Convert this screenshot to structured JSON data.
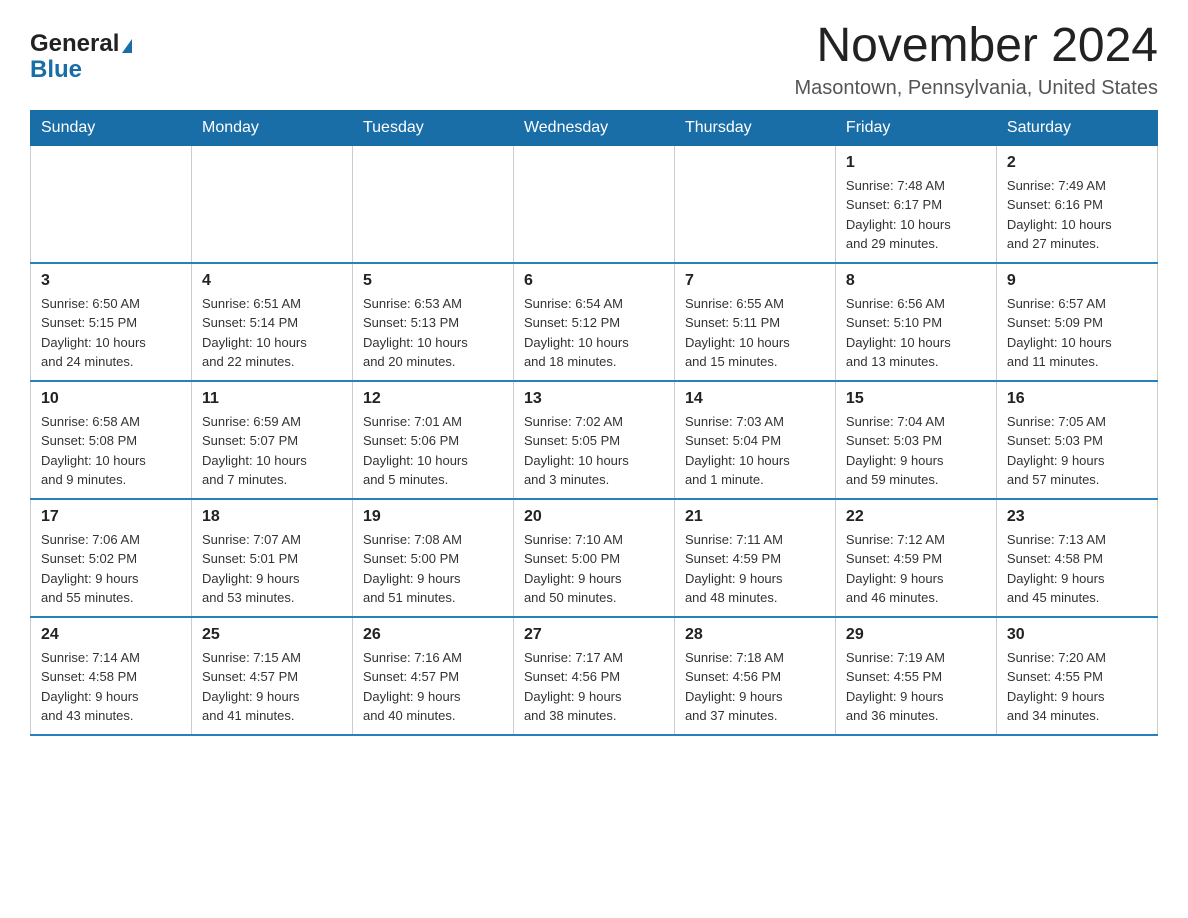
{
  "header": {
    "logo_general": "General",
    "logo_blue": "Blue",
    "month_title": "November 2024",
    "location": "Masontown, Pennsylvania, United States"
  },
  "weekdays": [
    "Sunday",
    "Monday",
    "Tuesday",
    "Wednesday",
    "Thursday",
    "Friday",
    "Saturday"
  ],
  "weeks": [
    [
      {
        "day": "",
        "info": ""
      },
      {
        "day": "",
        "info": ""
      },
      {
        "day": "",
        "info": ""
      },
      {
        "day": "",
        "info": ""
      },
      {
        "day": "",
        "info": ""
      },
      {
        "day": "1",
        "info": "Sunrise: 7:48 AM\nSunset: 6:17 PM\nDaylight: 10 hours\nand 29 minutes."
      },
      {
        "day": "2",
        "info": "Sunrise: 7:49 AM\nSunset: 6:16 PM\nDaylight: 10 hours\nand 27 minutes."
      }
    ],
    [
      {
        "day": "3",
        "info": "Sunrise: 6:50 AM\nSunset: 5:15 PM\nDaylight: 10 hours\nand 24 minutes."
      },
      {
        "day": "4",
        "info": "Sunrise: 6:51 AM\nSunset: 5:14 PM\nDaylight: 10 hours\nand 22 minutes."
      },
      {
        "day": "5",
        "info": "Sunrise: 6:53 AM\nSunset: 5:13 PM\nDaylight: 10 hours\nand 20 minutes."
      },
      {
        "day": "6",
        "info": "Sunrise: 6:54 AM\nSunset: 5:12 PM\nDaylight: 10 hours\nand 18 minutes."
      },
      {
        "day": "7",
        "info": "Sunrise: 6:55 AM\nSunset: 5:11 PM\nDaylight: 10 hours\nand 15 minutes."
      },
      {
        "day": "8",
        "info": "Sunrise: 6:56 AM\nSunset: 5:10 PM\nDaylight: 10 hours\nand 13 minutes."
      },
      {
        "day": "9",
        "info": "Sunrise: 6:57 AM\nSunset: 5:09 PM\nDaylight: 10 hours\nand 11 minutes."
      }
    ],
    [
      {
        "day": "10",
        "info": "Sunrise: 6:58 AM\nSunset: 5:08 PM\nDaylight: 10 hours\nand 9 minutes."
      },
      {
        "day": "11",
        "info": "Sunrise: 6:59 AM\nSunset: 5:07 PM\nDaylight: 10 hours\nand 7 minutes."
      },
      {
        "day": "12",
        "info": "Sunrise: 7:01 AM\nSunset: 5:06 PM\nDaylight: 10 hours\nand 5 minutes."
      },
      {
        "day": "13",
        "info": "Sunrise: 7:02 AM\nSunset: 5:05 PM\nDaylight: 10 hours\nand 3 minutes."
      },
      {
        "day": "14",
        "info": "Sunrise: 7:03 AM\nSunset: 5:04 PM\nDaylight: 10 hours\nand 1 minute."
      },
      {
        "day": "15",
        "info": "Sunrise: 7:04 AM\nSunset: 5:03 PM\nDaylight: 9 hours\nand 59 minutes."
      },
      {
        "day": "16",
        "info": "Sunrise: 7:05 AM\nSunset: 5:03 PM\nDaylight: 9 hours\nand 57 minutes."
      }
    ],
    [
      {
        "day": "17",
        "info": "Sunrise: 7:06 AM\nSunset: 5:02 PM\nDaylight: 9 hours\nand 55 minutes."
      },
      {
        "day": "18",
        "info": "Sunrise: 7:07 AM\nSunset: 5:01 PM\nDaylight: 9 hours\nand 53 minutes."
      },
      {
        "day": "19",
        "info": "Sunrise: 7:08 AM\nSunset: 5:00 PM\nDaylight: 9 hours\nand 51 minutes."
      },
      {
        "day": "20",
        "info": "Sunrise: 7:10 AM\nSunset: 5:00 PM\nDaylight: 9 hours\nand 50 minutes."
      },
      {
        "day": "21",
        "info": "Sunrise: 7:11 AM\nSunset: 4:59 PM\nDaylight: 9 hours\nand 48 minutes."
      },
      {
        "day": "22",
        "info": "Sunrise: 7:12 AM\nSunset: 4:59 PM\nDaylight: 9 hours\nand 46 minutes."
      },
      {
        "day": "23",
        "info": "Sunrise: 7:13 AM\nSunset: 4:58 PM\nDaylight: 9 hours\nand 45 minutes."
      }
    ],
    [
      {
        "day": "24",
        "info": "Sunrise: 7:14 AM\nSunset: 4:58 PM\nDaylight: 9 hours\nand 43 minutes."
      },
      {
        "day": "25",
        "info": "Sunrise: 7:15 AM\nSunset: 4:57 PM\nDaylight: 9 hours\nand 41 minutes."
      },
      {
        "day": "26",
        "info": "Sunrise: 7:16 AM\nSunset: 4:57 PM\nDaylight: 9 hours\nand 40 minutes."
      },
      {
        "day": "27",
        "info": "Sunrise: 7:17 AM\nSunset: 4:56 PM\nDaylight: 9 hours\nand 38 minutes."
      },
      {
        "day": "28",
        "info": "Sunrise: 7:18 AM\nSunset: 4:56 PM\nDaylight: 9 hours\nand 37 minutes."
      },
      {
        "day": "29",
        "info": "Sunrise: 7:19 AM\nSunset: 4:55 PM\nDaylight: 9 hours\nand 36 minutes."
      },
      {
        "day": "30",
        "info": "Sunrise: 7:20 AM\nSunset: 4:55 PM\nDaylight: 9 hours\nand 34 minutes."
      }
    ]
  ]
}
